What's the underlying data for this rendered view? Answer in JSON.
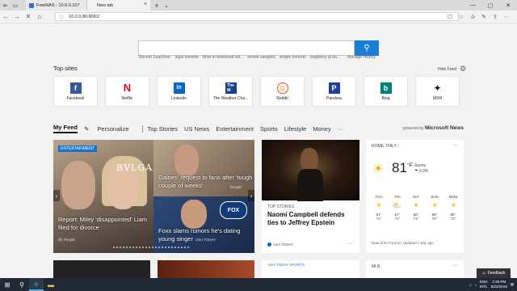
{
  "browser": {
    "tabs": [
      {
        "label": "FreeNAS - 10.0.0.107"
      },
      {
        "label": "New tab"
      }
    ],
    "address": "10.0.0.80:9091/"
  },
  "search": {
    "recent_label": "Recent Searches:",
    "recent": [
      "legal torrents",
      "what to download wit...",
      "torrent samples",
      "simple torrents",
      "raspberry pi do..."
    ],
    "manage_history": "Manage History"
  },
  "top_sites": {
    "title": "Top sites",
    "hide_feed": "Hide Feed",
    "sites": [
      {
        "label": "Facebook",
        "icon": "facebook-icon",
        "glyph": "f",
        "color": "#3b5998"
      },
      {
        "label": "Netflix",
        "icon": "netflix-icon",
        "glyph": "N",
        "color": "#e50914"
      },
      {
        "label": "Linkedin",
        "icon": "linkedin-icon",
        "glyph": "in",
        "color": "#0a66c2"
      },
      {
        "label": "The Weather Cha...",
        "icon": "weather-channel-icon",
        "glyph": "W",
        "color": "#1b3f8b"
      },
      {
        "label": "Reddit",
        "icon": "reddit-icon",
        "glyph": "☺",
        "color": "#ff4500"
      },
      {
        "label": "Pandora",
        "icon": "pandora-icon",
        "glyph": "P",
        "color": "#224099"
      },
      {
        "label": "Bing",
        "icon": "bing-icon",
        "glyph": "b",
        "color": "#008373"
      },
      {
        "label": "MSN",
        "icon": "msn-icon",
        "glyph": "✦",
        "color": "#111111"
      }
    ]
  },
  "feed_nav": {
    "my_feed": "My Feed",
    "personalize": "Personalize",
    "items": [
      "Top Stories",
      "US News",
      "Entertainment",
      "Sports",
      "Lifestyle",
      "Money"
    ],
    "more": "···",
    "powered_by": "powered by",
    "brand": "Microsoft News"
  },
  "hero": {
    "badge": "ENTERTAINMENT",
    "main_caption": "Report: Miley 'disappointed' Liam filed for divorce",
    "main_source": "People",
    "right_top_caption": "Gaines' request to fans after 'tough couple of weeks'",
    "right_top_source": "People",
    "right_bottom_caption": "Foxx slams rumors he's dating young singer",
    "right_bottom_source": "USA TODAY",
    "brand_text": "BVLGARI",
    "fox_text": "FOX"
  },
  "story": {
    "tag": "TOP STORIES",
    "title": "Naomi Campbell defends ties to Jeffrey Epstein",
    "source": "USA TODAY",
    "more": "···"
  },
  "weather": {
    "location": "ROME, ITALY",
    "temp": "81",
    "unit": "°F",
    "condition": "Sunny",
    "precip": "0.0%",
    "days": [
      {
        "name": "THU",
        "hi": "87°",
        "lo": "71°"
      },
      {
        "name": "FRI",
        "hi": "87°",
        "lo": "71°"
      },
      {
        "name": "SAT",
        "hi": "89°",
        "lo": "71°"
      },
      {
        "name": "SUN",
        "hi": "89°",
        "lo": "72°"
      },
      {
        "name": "MON",
        "hi": "89°",
        "lo": "72°"
      }
    ],
    "footer": "Data from Foreca | Updated 1 day ago",
    "more": "···"
  },
  "row2": {
    "usa_today": "USA TODAY SPORTS",
    "mlb": "MLB",
    "more": "···"
  },
  "feedback": "Feedback",
  "taskbar": {
    "lang": "ENG",
    "region": "INTL",
    "time": "2:48 PM",
    "date": "8/22/2019"
  }
}
